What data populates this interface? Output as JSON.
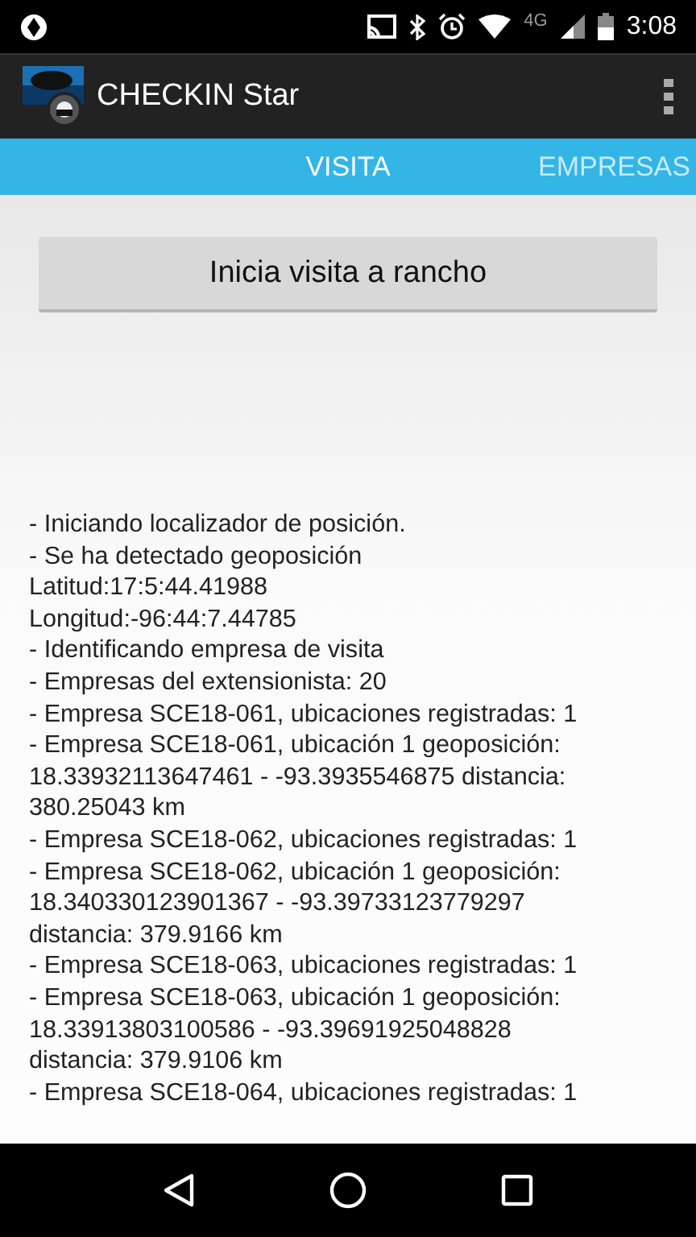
{
  "status_bar": {
    "network": "4G",
    "time": "3:08"
  },
  "app_bar": {
    "title": "CHECKIN Star"
  },
  "tabs": [
    {
      "label": "VISITA",
      "selected": true
    },
    {
      "label": "EMPRESAS",
      "selected": false
    }
  ],
  "visit_button": {
    "label": "Inicia visita a rancho"
  },
  "log_lines": [
    "- Iniciando localizador de posición.",
    "- Se ha detectado geoposición",
    "Latitud:17:5:44.41988",
    "Longitud:-96:44:7.44785",
    "- Identificando empresa de visita",
    "- Empresas del extensionista: 20",
    "- Empresa SCE18-061, ubicaciones registradas: 1",
    "- Empresa SCE18-061, ubicación 1 geoposición:",
    "18.33932113647461 - -93.3935546875 distancia:",
    "380.25043 km",
    "- Empresa SCE18-062, ubicaciones registradas: 1",
    "- Empresa SCE18-062, ubicación 1 geoposición:",
    "18.340330123901367 - -93.39733123779297",
    "distancia: 379.9166 km",
    "- Empresa SCE18-063, ubicaciones registradas: 1",
    "- Empresa SCE18-063, ubicación 1 geoposición:",
    "18.33913803100586 - -93.39691925048828",
    "distancia: 379.9106 km",
    "- Empresa SCE18-064, ubicaciones registradas: 1"
  ]
}
